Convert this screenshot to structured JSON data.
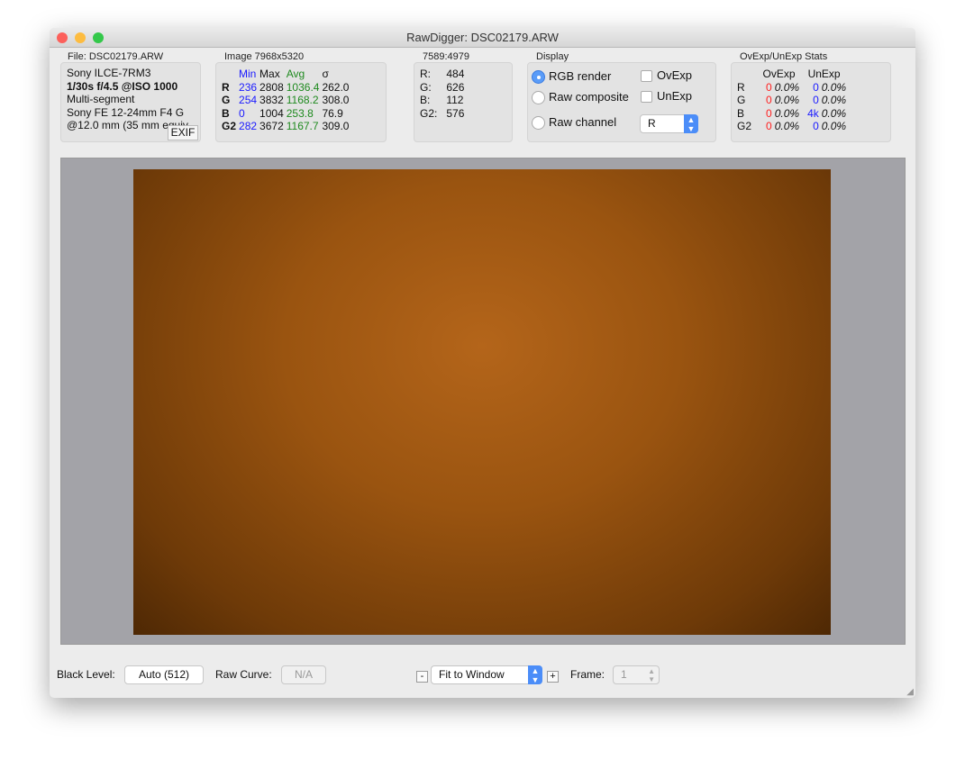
{
  "window": {
    "title": "RawDigger: DSC02179.ARW"
  },
  "file": {
    "label": "File: DSC02179.ARW",
    "lines": [
      "Sony ILCE-7RM3",
      "1/30s f/4.5 @ISO 1000",
      "Multi-segment",
      "Sony FE 12-24mm F4 G",
      "@12.0 mm (35 mm equiv"
    ],
    "exif_button": "EXIF"
  },
  "image_stats": {
    "label": "Image 7968x5320",
    "headers": [
      "Min",
      "Max",
      "Avg",
      "σ"
    ],
    "rows": [
      {
        "ch": "R",
        "min": "236",
        "max": "2808",
        "avg": "1036.4",
        "sd": "262.0"
      },
      {
        "ch": "G",
        "min": "254",
        "max": "3832",
        "avg": "1168.2",
        "sd": "308.0"
      },
      {
        "ch": "B",
        "min": "0",
        "max": "1004",
        "avg": "253.8",
        "sd": "76.9"
      },
      {
        "ch": "G2",
        "min": "282",
        "max": "3672",
        "avg": "1167.7",
        "sd": "309.0"
      }
    ]
  },
  "pixel": {
    "label": "7589:4979",
    "rows": [
      {
        "ch": "R:",
        "v": "484"
      },
      {
        "ch": "G:",
        "v": "626"
      },
      {
        "ch": "B:",
        "v": "112"
      },
      {
        "ch": "G2:",
        "v": "576"
      }
    ]
  },
  "display": {
    "label": "Display",
    "rgb_render": "RGB render",
    "raw_composite": "Raw composite",
    "raw_channel": "Raw channel",
    "selected": "RGB render",
    "ovexp": "OvExp",
    "unexp": "UnExp",
    "ovexp_checked": false,
    "unexp_checked": false,
    "channel_value": "R"
  },
  "exp_stats": {
    "label": "OvExp/UnExp Stats",
    "headers": [
      "OvExp",
      "UnExp"
    ],
    "rows": [
      {
        "ch": "R",
        "ov": "0",
        "ovp": "0.0%",
        "un": "0",
        "unp": "0.0%"
      },
      {
        "ch": "G",
        "ov": "0",
        "ovp": "0.0%",
        "un": "0",
        "unp": "0.0%"
      },
      {
        "ch": "B",
        "ov": "0",
        "ovp": "0.0%",
        "un": "4k",
        "unp": "0.0%"
      },
      {
        "ch": "G2",
        "ov": "0",
        "ovp": "0.0%",
        "un": "0",
        "unp": "0.0%"
      }
    ]
  },
  "bottom": {
    "black_level_label": "Black Level:",
    "black_level_value": "Auto (512)",
    "raw_curve_label": "Raw Curve:",
    "raw_curve_value": "N/A",
    "zoom_minus": "-",
    "zoom_value": "Fit to Window",
    "zoom_plus": "+",
    "frame_label": "Frame:",
    "frame_value": "1"
  },
  "colors": {
    "min": "#1a1aff",
    "avg": "#1f8a1f",
    "ovexp": "#ff2020",
    "unexp": "#1a1aff",
    "accent": "#4b8df8"
  }
}
